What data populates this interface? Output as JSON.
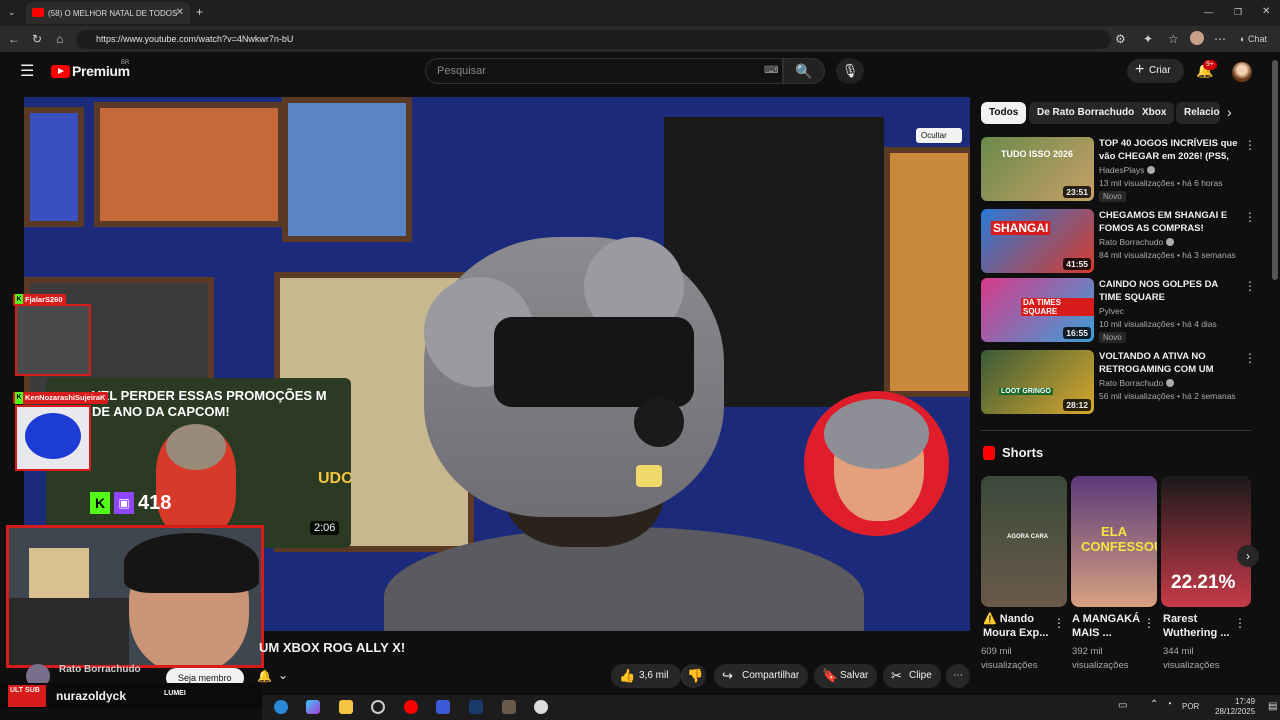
{
  "browser": {
    "tab_title": "(58) O MELHOR NATAL DE TODOS",
    "tab_close": "✕",
    "new_tab": "+",
    "url": "https://www.youtube.com/watch?v=4Nwkwr7n-bU",
    "ai_label": "Chat"
  },
  "youtube": {
    "logo_text": "Premium",
    "logo_region": "BR",
    "search_placeholder": "Pesquisar",
    "create_label": "Criar",
    "notification_count": "9+"
  },
  "video": {
    "hide_label": "Ocultar",
    "title_visible": "UM XBOX ROG ALLY X!",
    "channel": "Rato Borrachudo",
    "join_label": "Seja membro",
    "likes": "3,6 mil",
    "share_label": "Compartilhar",
    "save_label": "Salvar",
    "clip_label": "Clipe"
  },
  "stream_overlay": {
    "viewer1": "FjalarS260",
    "viewer2": "KenNozarashiSujeiraK",
    "thumb_text": "VEL PERDER ESSAS PROMOÇÕES M DE ANO DA CAPCOM!",
    "thumb_duration": "2:06",
    "viewer_count": "418",
    "streamer": "nurazoldyck",
    "streamer_logo": "ULT SUB",
    "brand": "LUMEI",
    "shirt_text": "UDO"
  },
  "sidebar": {
    "chips": [
      {
        "label": "Todos",
        "active": true
      },
      {
        "label": "De Rato Borrachudo",
        "active": false
      },
      {
        "label": "Xbox",
        "active": false
      },
      {
        "label": "Relacio",
        "active": false
      }
    ],
    "recommendations": [
      {
        "title": "TOP 40 JOGOS INCRÍVEIS que vão CHEGAR em 2026! (PS5, ...",
        "channel": "HadesPlays",
        "meta": "13 mil visualizações • há 6 horas",
        "duration": "23:51",
        "badge": "Novo",
        "thumb_text": "TUDO ISSO 2026"
      },
      {
        "title": "CHEGAMOS EM SHANGAI E FOMOS AS COMPRAS! RATÃO...",
        "channel": "Rato Borrachudo",
        "meta": "84 mil visualizações • há 3 semanas",
        "duration": "41:55",
        "badge": "",
        "thumb_text": "SHANGAI"
      },
      {
        "title": "CAINDO NOS GOLPES DA TIME SQUARE",
        "channel": "Pylvec",
        "meta": "10 mil visualizações • há 4 dias",
        "duration": "16:55",
        "badge": "Novo",
        "thumb_text": "DA TIMES SQUARE"
      },
      {
        "title": "VOLTANDO A ATIVA NO RETROGAMING COM UM LOT...",
        "channel": "Rato Borrachudo",
        "meta": "56 mil visualizações • há 2 semanas",
        "duration": "28:12",
        "badge": "",
        "thumb_text": "LOOT GRINGO"
      }
    ],
    "shorts_title": "Shorts",
    "shorts": [
      {
        "title": "⚠️ Nando Moura Exp...",
        "views": "609 mil visualizações",
        "thumb_text": "AGORA CARA"
      },
      {
        "title": "A MANGAKÁ MAIS ...",
        "views": "392 mil visualizações",
        "thumb_text": "ELA CONFESSOU?"
      },
      {
        "title": "Rarest Wuthering ...",
        "views": "344 mil visualizações",
        "thumb_text": "22.21%"
      }
    ]
  },
  "taskbar": {
    "lang": "POR",
    "time": "17:49",
    "date": "28/12/2025"
  },
  "icons": {
    "menu": "☰",
    "search": "🔍",
    "mic": "🎙",
    "bell": "🔔",
    "like": "👍",
    "dislike": "👎",
    "share": "↪",
    "save": "🔖",
    "clip": "✂",
    "more": "⋯",
    "kebab": "⋮",
    "chevron_right": "›",
    "chevron_down": "⌄"
  }
}
